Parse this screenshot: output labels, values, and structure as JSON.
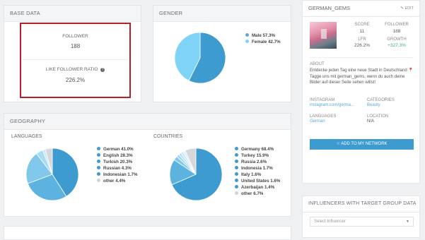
{
  "base_data": {
    "title": "BASE DATA",
    "follower_label": "FOLLOWER",
    "follower_value": "188",
    "ratio_label": "LIKE FOLLOWER RATIO",
    "ratio_info_icon": "info-icon",
    "ratio_value": "226.2%"
  },
  "gender": {
    "title": "GENDER",
    "legend": [
      {
        "label": "Male 57.3%",
        "color": "#5aa9d6"
      },
      {
        "label": "Female 42.7%",
        "color": "#7fd3f7"
      }
    ],
    "chart_data": {
      "type": "pie",
      "categories": [
        "Male",
        "Female"
      ],
      "values": [
        57.3,
        42.7
      ],
      "colors": [
        "#3d9bd0",
        "#7fd3f7"
      ]
    }
  },
  "geography": {
    "title": "GEOGRAPHY",
    "languages_title": "LANGUAGES",
    "countries_title": "COUNTRIES",
    "languages_legend": [
      {
        "label": "German 41.0%",
        "color": "#3d9bd0"
      },
      {
        "label": "English 28.3%",
        "color": "#3d9bd0"
      },
      {
        "label": "Turkish 20.3%",
        "color": "#3d9bd0"
      },
      {
        "label": "Russian 4.3%",
        "color": "#3d9bd0"
      },
      {
        "label": "Indonesian 1.7%",
        "color": "#3d9bd0"
      },
      {
        "label": "other 4.4%",
        "color": "#cfd3d7"
      }
    ],
    "countries_legend": [
      {
        "label": "Germany 68.4%",
        "color": "#3d9bd0"
      },
      {
        "label": "Turkey 15.9%",
        "color": "#3d9bd0"
      },
      {
        "label": "Russia 2.6%",
        "color": "#3d9bd0"
      },
      {
        "label": "Indonesia 1.7%",
        "color": "#3d9bd0"
      },
      {
        "label": "Italy 1.6%",
        "color": "#3d9bd0"
      },
      {
        "label": "United States 1.6%",
        "color": "#3d9bd0"
      },
      {
        "label": "Azerbaijan 1.4%",
        "color": "#3d9bd0"
      },
      {
        "label": "other 6.7%",
        "color": "#cfd3d7"
      }
    ]
  },
  "chart_data": [
    {
      "type": "pie",
      "name": "LANGUAGES",
      "categories": [
        "German",
        "English",
        "Turkish",
        "Russian",
        "Indonesian",
        "other"
      ],
      "values": [
        41.0,
        28.3,
        20.3,
        4.3,
        1.7,
        4.4
      ],
      "colors": [
        "#3d9bd0",
        "#5cb3e0",
        "#82c8ec",
        "#a8dbf4",
        "#c6e9f9",
        "#d5d8db"
      ]
    },
    {
      "type": "pie",
      "name": "COUNTRIES",
      "categories": [
        "Germany",
        "Turkey",
        "Russia",
        "Indonesia",
        "Italy",
        "United States",
        "Azerbaijan",
        "other"
      ],
      "values": [
        68.4,
        15.9,
        2.6,
        1.7,
        1.6,
        1.6,
        1.4,
        6.7
      ],
      "colors": [
        "#3d9bd0",
        "#5cb3e0",
        "#82c8ec",
        "#9fd6f2",
        "#b8e2f6",
        "#cdeaf9",
        "#dcf1fb",
        "#d5d8db"
      ]
    }
  ],
  "profile": {
    "username": "GERMAN_GEMS",
    "edit_label": "EDIT",
    "edit_icon": "edit-icon",
    "score_label": "SCORE",
    "score_value": "11",
    "follower_label": "FOLLOWER",
    "follower_value": "188",
    "lfr_label": "LFR",
    "lfr_value": "226.2%",
    "growth_label": "GROWTH",
    "growth_value": "+327.3%",
    "about_label": "ABOUT",
    "about_text": "Entdecke jeden Tag eine neue Stadt in Deutschland 📍 Tagge uns mit german_gems, wenn du auch deine Bilder auf dieser Seite sehen willst!",
    "instagram_label": "INSTAGRAM",
    "instagram_value": "instagram.com/germa...",
    "categories_label": "CATEGORIES",
    "categories_value": "Beauty",
    "languages_label": "LANGUAGES",
    "languages_value": "German",
    "location_label": "LOCATION",
    "location_value": "N/A",
    "add_button": "ADD TO MY NETWORK",
    "add_icon": "star-icon",
    "accent": "#3d9bd0",
    "growth_color": "#3cb371"
  },
  "target_group": {
    "title": "INFLUENCERS WITH TARGET GROUP DATA",
    "select_placeholder": "Select Influencer",
    "select_icon": "chevron-down-icon"
  }
}
